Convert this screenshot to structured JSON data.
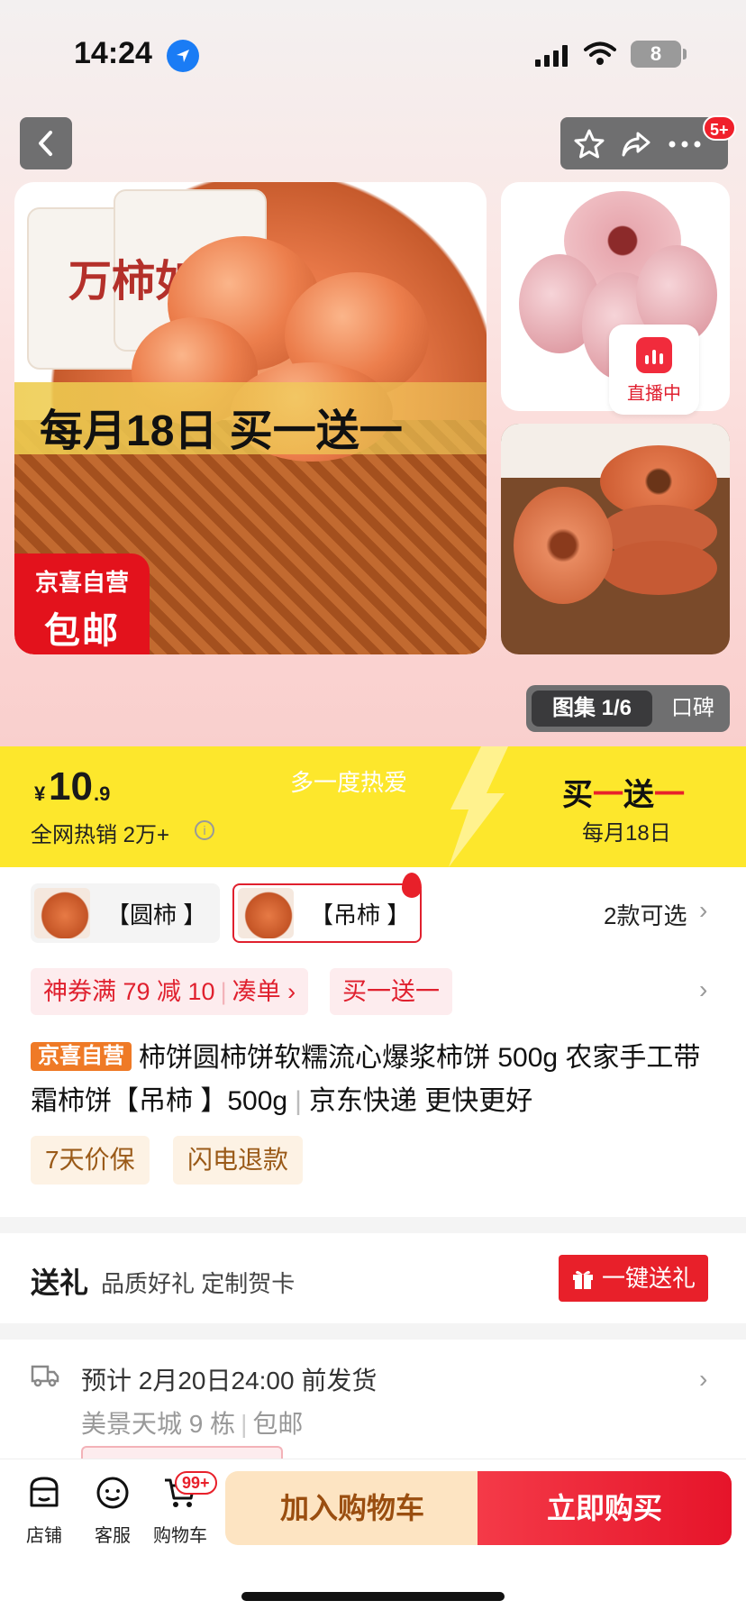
{
  "status_bar": {
    "time": "14:24",
    "battery": "8"
  },
  "header": {
    "cart_badge": "5+"
  },
  "gallery": {
    "main_promo": "每月18日 买一送一",
    "badge_line1": "京喜自营",
    "badge_line2": "包邮",
    "bag_text": "万柿如意",
    "live_label": "直播中",
    "tab_gallery": "图集 1/6",
    "tab_reviews": "口碑"
  },
  "price": {
    "currency": "¥",
    "integer": "10",
    "decimal": ".9",
    "hot_sales": "全网热销 2万+",
    "slogan": "多一度热爱",
    "bogo_a": "买",
    "bogo_dash1": "一",
    "bogo_b": "送",
    "bogo_dash2": "一",
    "bogo_date": "每月18日"
  },
  "variants": {
    "items": [
      {
        "label": "【圆柿 】"
      },
      {
        "label": "【吊柿 】"
      }
    ],
    "count_label": "2款可选"
  },
  "coupons": {
    "main": "神券满 79 减 10",
    "link": "凑单 ›",
    "bogo": "买一送一"
  },
  "product": {
    "tag": "京喜自营",
    "title": "柿饼圆柿饼软糯流心爆浆柿饼 500g 农家手工带霜柿饼【吊柿 】500g",
    "title_suffix": "京东快递 更快更好",
    "services": [
      "7天价保",
      "闪电退款"
    ]
  },
  "gift": {
    "title": "送礼",
    "subtitle": "品质好礼 定制贺卡",
    "button": "一键送礼"
  },
  "shipping": {
    "estimate": "预计 2月20日24:00 前发货",
    "address": "美景天城 9 栋",
    "free_shipping": "包邮"
  },
  "bottom_nav": {
    "shop": "店铺",
    "service": "客服",
    "cart": "购物车",
    "cart_badge": "99+",
    "add_to_cart": "加入购物车",
    "buy_now": "立即购买"
  },
  "colors": {
    "brand_red": "#e8202a",
    "price_band": "#fde72c",
    "jx_orange": "#ef7a26"
  }
}
